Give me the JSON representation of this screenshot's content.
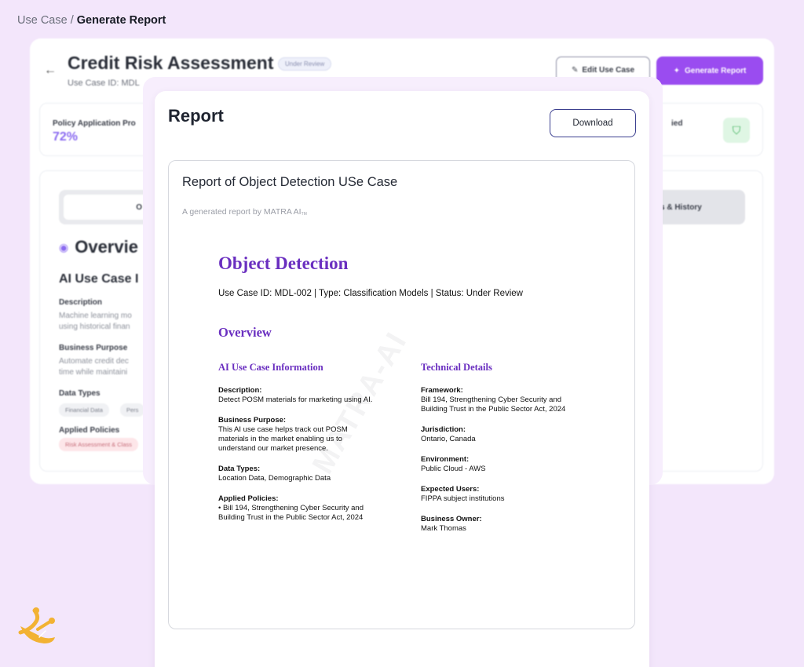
{
  "breadcrumb": {
    "parent": "Use Case",
    "separator": " / ",
    "current": "Generate Report"
  },
  "background_page": {
    "title": "Credit Risk Assessment",
    "status_badge": "Under Review",
    "use_case_id": "Use Case ID: MDL",
    "edit_button": "Edit Use Case",
    "generate_button": "Generate Report",
    "stat_label": "Policy Application Pro",
    "stat_value": "72%",
    "stat_label_right": "ied",
    "tab_left": "O",
    "tab_right": "s & History",
    "overview_heading": "Overvie",
    "ai_use_case_heading": "AI Use Case I",
    "description_label": "Description",
    "description_text": "Machine learning mo\nusing historical finan",
    "business_purpose_label": "Business Purpose",
    "business_purpose_text": "Automate credit dec\ntime while maintaini",
    "data_types_label": "Data Types",
    "data_type_chips": [
      "Financial Data",
      "Pers"
    ],
    "applied_policies_label": "Applied Policies",
    "policy_chip": "Risk Assessment & Class"
  },
  "report_modal": {
    "title": "Report",
    "download_button": "Download",
    "report_title": "Report of Object Detection USe Case",
    "subtitle": "A generated report by MATRA AI",
    "subtitle_tm": "TM",
    "watermark": "MATRA-AI",
    "document": {
      "title": "Object Detection",
      "meta": "Use Case ID: MDL-002 | Type: Classification Models | Status: Under Review",
      "overview_heading": "Overview",
      "left_heading": "AI Use Case Information",
      "left_fields": [
        {
          "label": "Description:",
          "value": "Detect POSM materials for marketing using AI."
        },
        {
          "label": "Business Purpose:",
          "value": "This AI use case helps track out POSM\nmaterials in the market enabling us to\nunderstand our market presence."
        },
        {
          "label": "Data Types:",
          "value": "Location Data, Demographic Data"
        },
        {
          "label": "Applied Policies:",
          "value": "• Bill 194, Strengthening Cyber Security and\nBuilding Trust in the Public Sector Act, 2024"
        }
      ],
      "right_heading": "Technical Details",
      "right_fields": [
        {
          "label": "Framework:",
          "value": "Bill 194, Strengthening Cyber Security and\nBuilding Trust in the Public Sector Act, 2024"
        },
        {
          "label": "Jurisdiction:",
          "value": "Ontario, Canada"
        },
        {
          "label": "Environment:",
          "value": "Public Cloud - AWS"
        },
        {
          "label": "Expected Users:",
          "value": "FIPPA subject institutions"
        },
        {
          "label": "Business Owner:",
          "value": "Mark Thomas"
        }
      ]
    }
  },
  "colors": {
    "accent": "#6a2fc0",
    "primary_button": "#9a4cf0",
    "page_bg": "#f3e6fb",
    "logo": "#f2b233"
  }
}
